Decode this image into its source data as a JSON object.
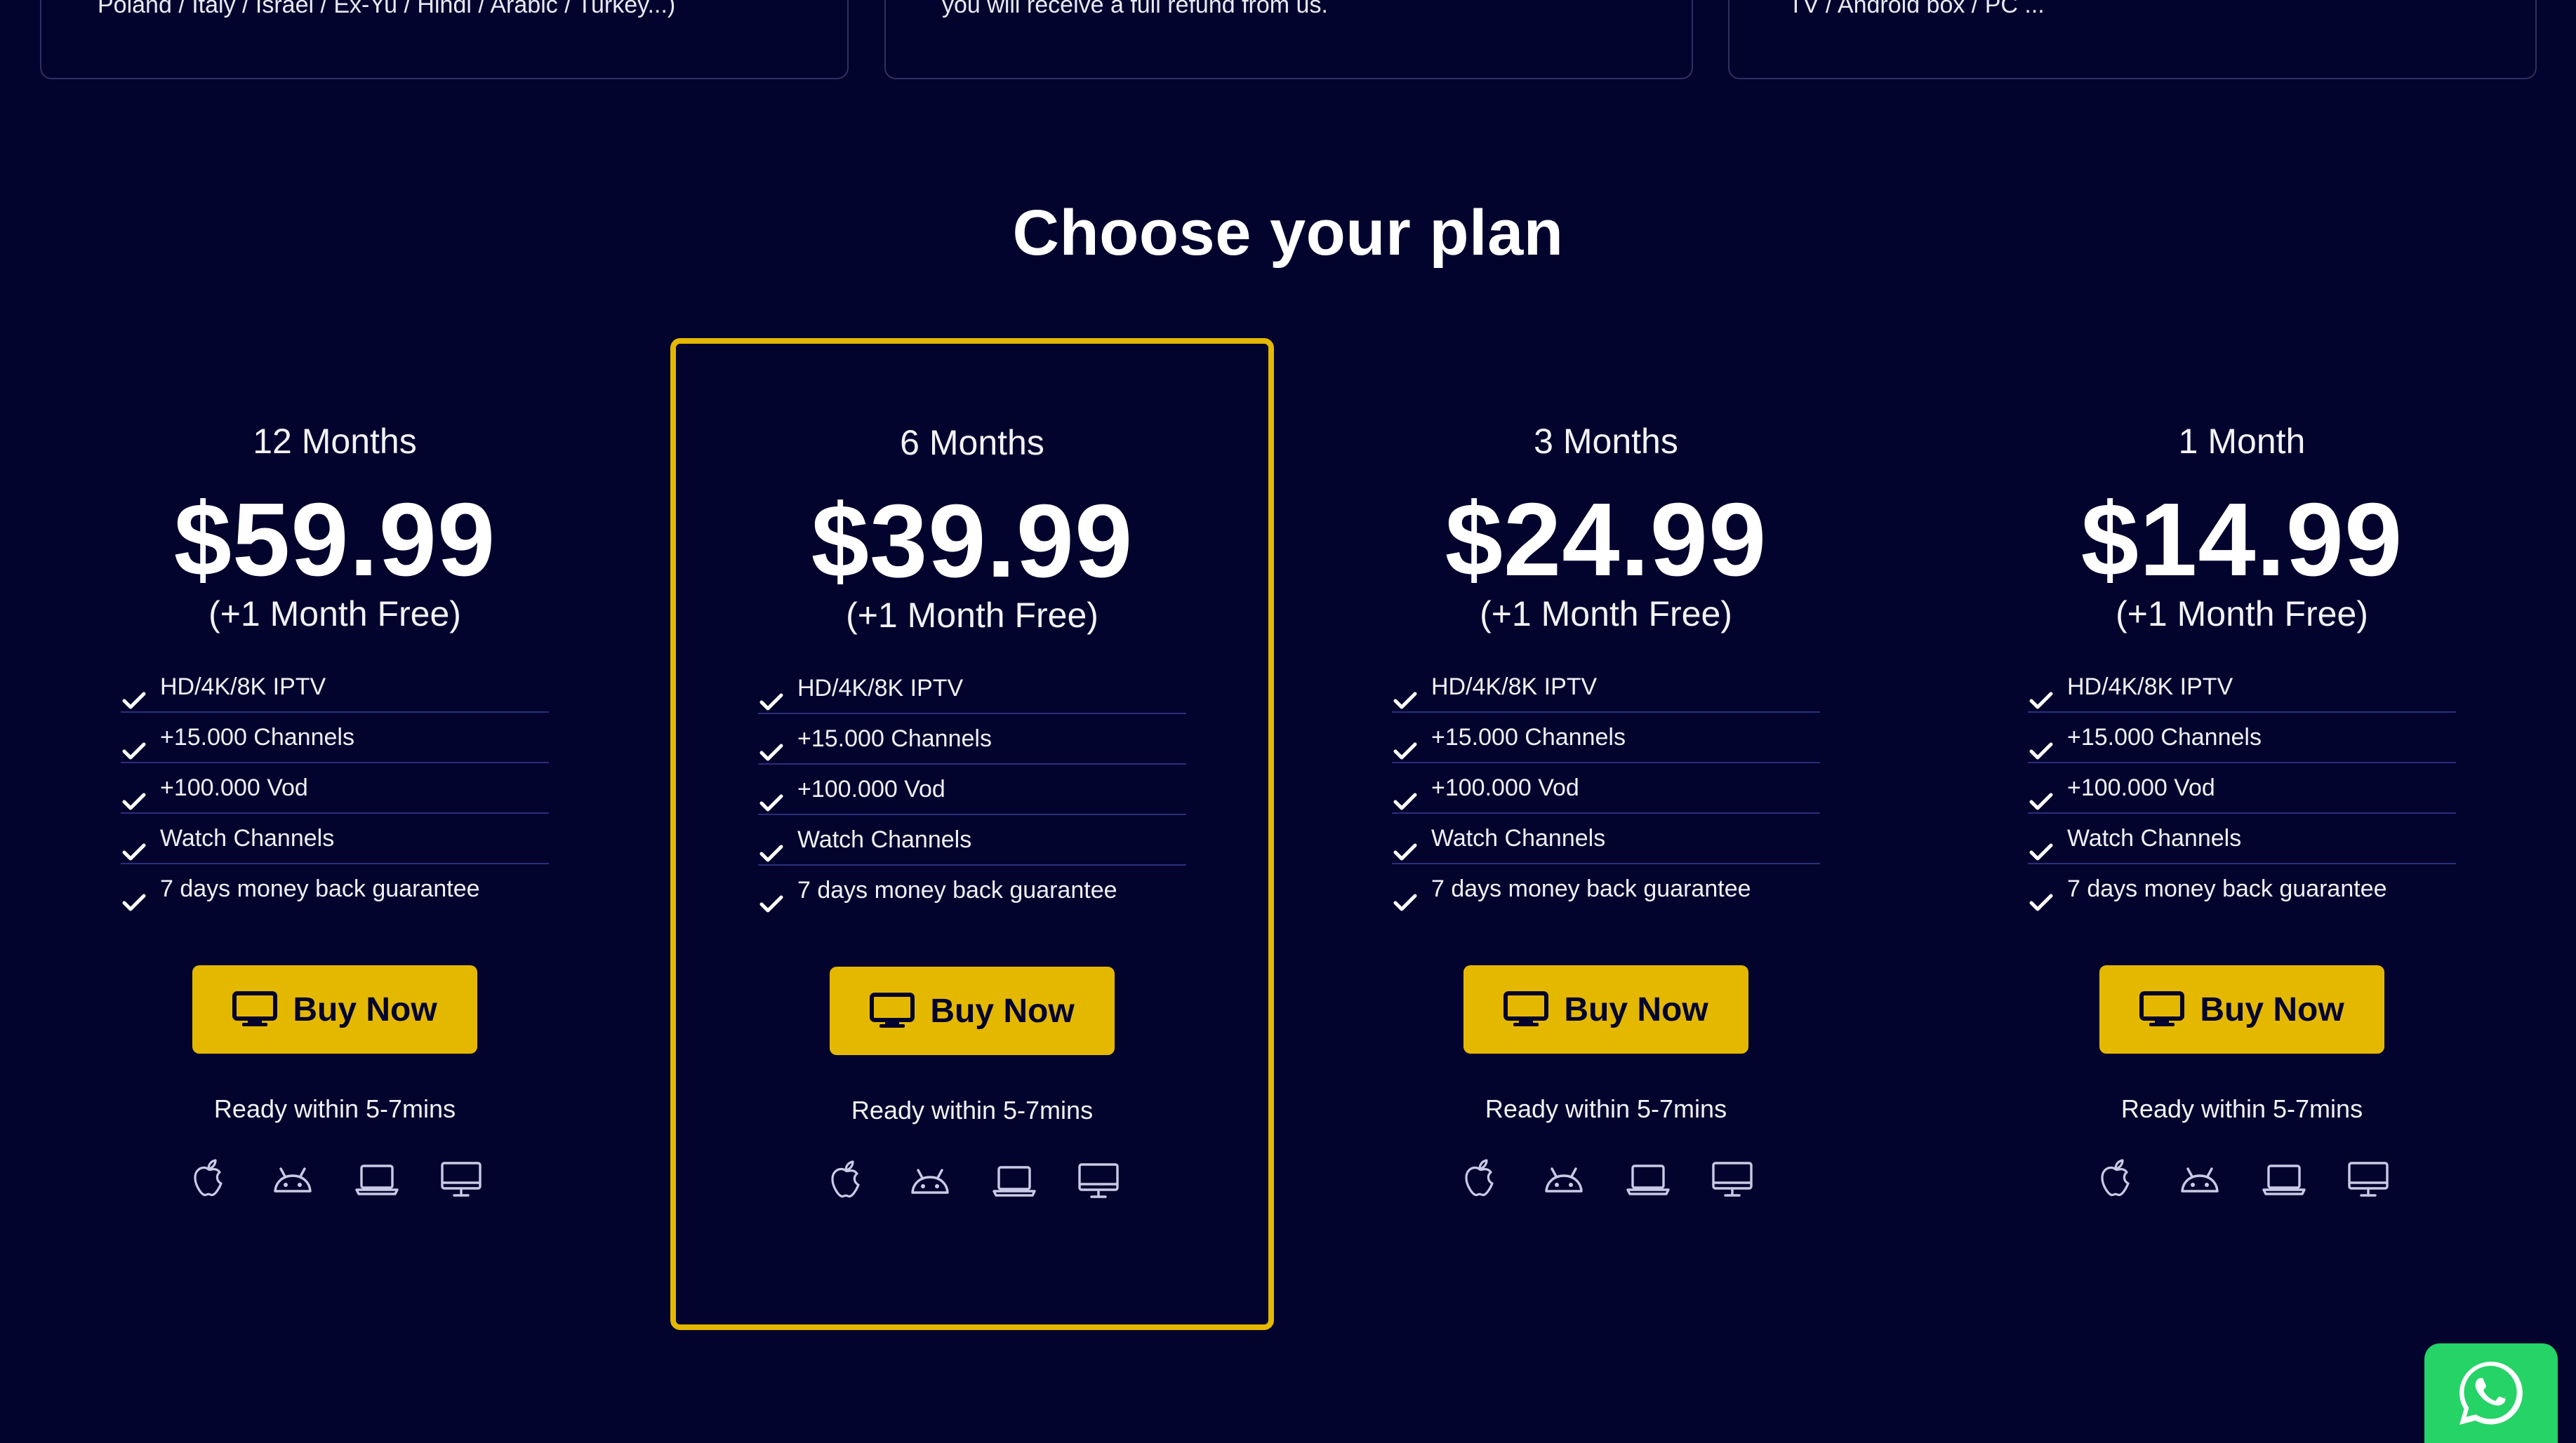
{
  "top_cards": [
    {
      "text": "Poland / Italy / Israel / Ex-Yu / Hindi / Arabic / Turkey...)"
    },
    {
      "text": "you will receive a full refund from us."
    },
    {
      "text": "TV / Android box / PC ..."
    }
  ],
  "section": {
    "title": "Choose your plan"
  },
  "plans": [
    {
      "duration": "12 Months",
      "price": "$59.99",
      "bonus": "(+1 Month Free)",
      "features": [
        "HD/4K/8K IPTV",
        "+15.000 Channels",
        "+100.000 Vod",
        "Watch Channels",
        "7 days money back guarantee"
      ],
      "button": "Buy Now",
      "ready": "Ready within 5-7mins",
      "featured": false
    },
    {
      "duration": "6 Months",
      "price": "$39.99",
      "bonus": "(+1 Month Free)",
      "features": [
        "HD/4K/8K IPTV",
        "+15.000 Channels",
        "+100.000 Vod",
        "Watch Channels",
        "7 days money back guarantee"
      ],
      "button": "Buy Now",
      "ready": "Ready within 5-7mins",
      "featured": true
    },
    {
      "duration": "3 Months",
      "price": "$24.99",
      "bonus": "(+1 Month Free)",
      "features": [
        "HD/4K/8K IPTV",
        "+15.000 Channels",
        "+100.000 Vod",
        "Watch Channels",
        "7 days money back guarantee"
      ],
      "button": "Buy Now",
      "ready": "Ready within 5-7mins",
      "featured": false
    },
    {
      "duration": "1 Month",
      "price": "$14.99",
      "bonus": "(+1 Month Free)",
      "features": [
        "HD/4K/8K IPTV",
        "+15.000 Channels",
        "+100.000 Vod",
        "Watch Channels",
        "7 days money back guarantee"
      ],
      "button": "Buy Now",
      "ready": "Ready within 5-7mins",
      "featured": false
    }
  ],
  "icons": {
    "button": "monitor-icon",
    "devices": [
      "apple-icon",
      "android-icon",
      "laptop-icon",
      "desktop-icon"
    ],
    "floating": "whatsapp-icon"
  },
  "colors": {
    "background": "#03042e",
    "accent": "#e5b800",
    "divider": "#2a2e7a",
    "whatsapp": "#25d366"
  }
}
